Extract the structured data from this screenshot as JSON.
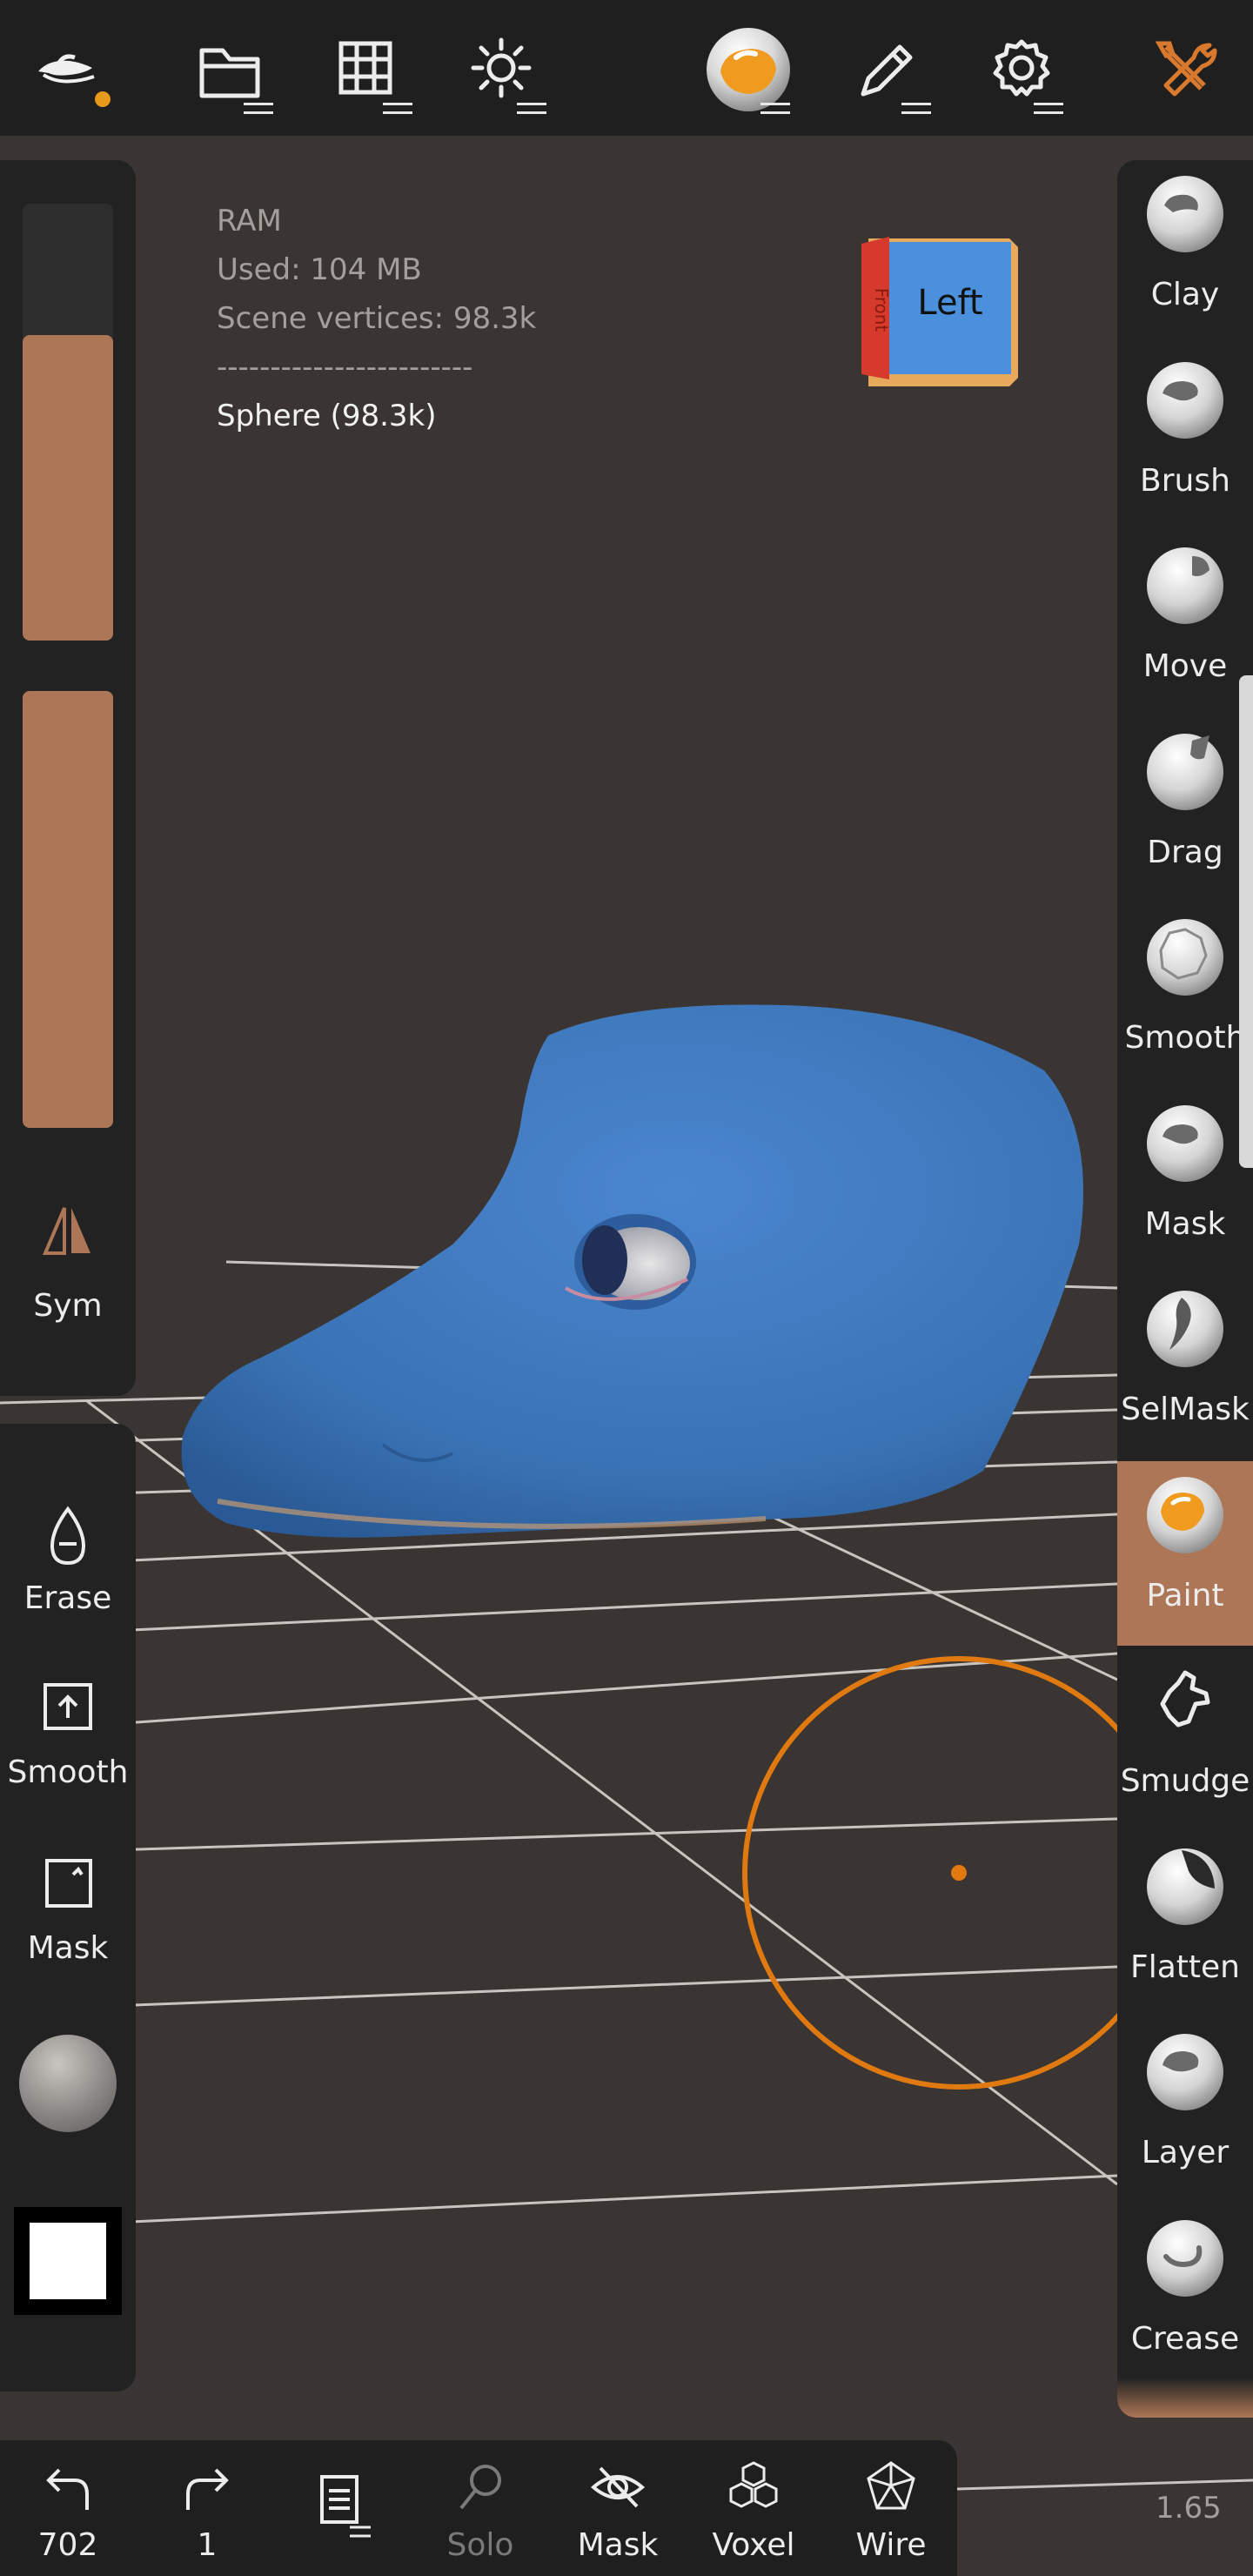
{
  "colors": {
    "accent": "#e07a10",
    "paint_color": "#ad7656",
    "panel_bg": "#222222",
    "viewport_bg": "#3a3532",
    "model_blue": "#3a73b5"
  },
  "top_toolbar": {
    "icons": [
      "logo-icon",
      "folder-icon",
      "grid-icon",
      "sun-icon",
      "material-sphere-icon",
      "pen-icon",
      "gear-icon",
      "tools-icon"
    ]
  },
  "info": {
    "ram": "RAM",
    "used": "Used: 104 MB",
    "scene_vertices": "Scene vertices: 98.3k",
    "separator": "------------------------",
    "object": "Sphere (98.3k)"
  },
  "view_cube": {
    "label": "Left",
    "side_label": "Front"
  },
  "left_panel": {
    "sym_label": "Sym",
    "erase_label": "Erase",
    "smooth_label": "Smooth",
    "mask_label": "Mask",
    "radius_slider_level": 0.7,
    "intensity_slider_level": 1.0
  },
  "tools": [
    {
      "label": "Clay",
      "icon": "clay-icon",
      "active": false
    },
    {
      "label": "Brush",
      "icon": "brush-icon",
      "active": false
    },
    {
      "label": "Move",
      "icon": "move-icon",
      "active": false
    },
    {
      "label": "Drag",
      "icon": "drag-icon",
      "active": false
    },
    {
      "label": "Smooth",
      "icon": "smooth-icon",
      "active": false
    },
    {
      "label": "Mask",
      "icon": "mask-icon",
      "active": false
    },
    {
      "label": "SelMask",
      "icon": "selmask-icon",
      "active": false
    },
    {
      "label": "Paint",
      "icon": "paint-icon",
      "active": true
    },
    {
      "label": "Smudge",
      "icon": "smudge-icon",
      "active": false
    },
    {
      "label": "Flatten",
      "icon": "flatten-icon",
      "active": false
    },
    {
      "label": "Layer",
      "icon": "layer-icon",
      "active": false
    },
    {
      "label": "Crease",
      "icon": "crease-icon",
      "active": false
    }
  ],
  "bottom_bar": {
    "undo_count": "702",
    "redo_count": "1",
    "solo_label": "Solo",
    "mask_label": "Mask",
    "voxel_label": "Voxel",
    "wire_label": "Wire"
  },
  "zoom_level": "1.65"
}
